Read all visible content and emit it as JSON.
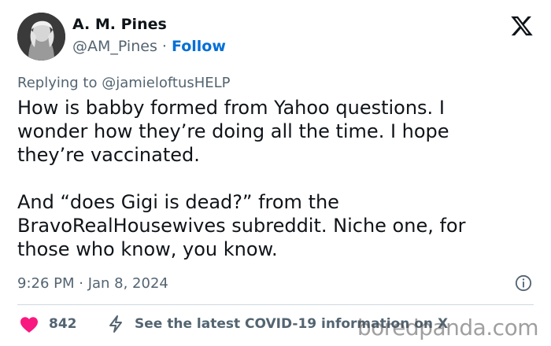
{
  "author": {
    "display_name": "A. M. Pines",
    "handle": "@AM_Pines",
    "separator": "·",
    "follow_label": "Follow",
    "avatar_icon": "avatar-portrait-icon"
  },
  "reply": {
    "prefix": "Replying to",
    "handle": "@jamieloftusHELP"
  },
  "tweet": {
    "paragraphs": [
      "How is babby formed from Yahoo questions.  I\nwonder how they’re doing all the time. I hope\nthey’re vaccinated.",
      "And “does Gigi is dead?” from the\nBravoRealHousewives subreddit. Niche one, for\nthose who know, you know."
    ],
    "timestamp": "9:26 PM · Jan 8, 2024"
  },
  "footer": {
    "like_count": "842",
    "covid_label": "See the latest COVID-19 information on X"
  },
  "watermark": "boredpanda.com",
  "colors": {
    "heart": "#f91880",
    "link": "#006fd6",
    "muted": "#536471"
  }
}
